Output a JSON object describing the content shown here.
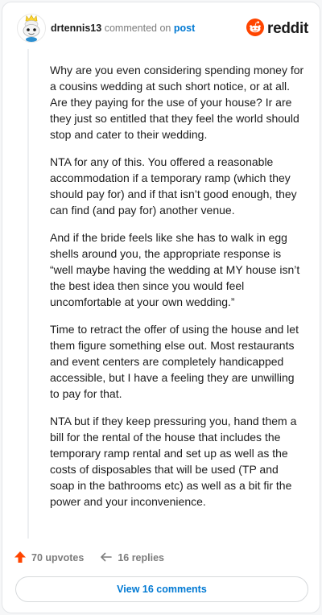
{
  "header": {
    "username": "drtennis13",
    "commented_text": "commented on",
    "post_link": "post",
    "brand": "reddit",
    "avatar_icon": "snoo-avatar-icon",
    "brand_icon": "reddit-snoo-icon"
  },
  "comment": {
    "paragraphs": [
      "Why are you even considering spending money for a cousins wedding at such short notice, or at all. Are they paying for the use of your house? Ir are they just so entitled that they feel the world should stop and cater to their wedding.",
      "NTA for any of this. You offered a reasonable accommodation if a temporary ramp (which they should pay for) and if that isn’t good enough, they can find (and pay for) another venue.",
      "And if the bride feels like she has to walk in egg shells around you, the appropriate response is “well maybe having the wedding at MY house isn’t the best idea then since you would feel uncomfortable at your own wedding.”",
      "Time to retract the offer of using the house and let them figure something else out. Most restaurants and event centers are completely handicapped accessible, but I have a feeling they are unwilling to pay for that.",
      "NTA but if they keep pressuring you, hand them a bill for the rental of the house that includes the temporary ramp rental and set up as well as the costs of disposables that will be used (TP and soap in the bathrooms etc) as well as a bit fir the power and your inconvenience."
    ]
  },
  "actions": {
    "upvotes": "70 upvotes",
    "replies": "16 replies",
    "upvote_icon": "upvote-arrow-icon",
    "reply_icon": "reply-arrow-icon"
  },
  "view_button": "View 16 comments",
  "colors": {
    "accent": "#0079d3",
    "upvote": "#ff4500",
    "brand": "#ff4500",
    "text": "#1c1c1c",
    "muted": "#7c7c7c"
  }
}
